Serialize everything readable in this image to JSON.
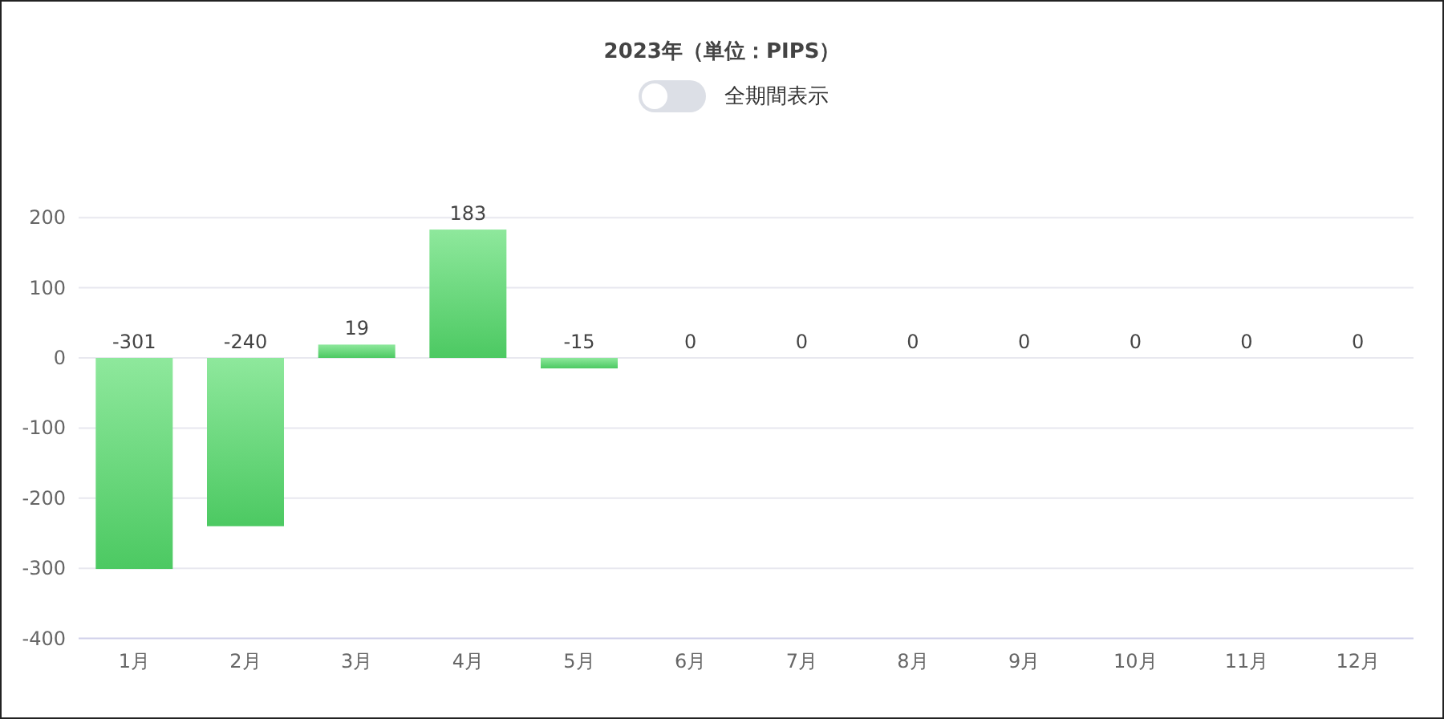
{
  "title": "2023年（単位：PIPS）",
  "toggle": {
    "label": "全期間表示",
    "on": false
  },
  "chart_data": {
    "type": "bar",
    "categories": [
      "1月",
      "2月",
      "3月",
      "4月",
      "5月",
      "6月",
      "7月",
      "8月",
      "9月",
      "10月",
      "11月",
      "12月"
    ],
    "series": [
      {
        "color": "#4cc962",
        "values": [
          -301,
          -240,
          19,
          183,
          -15,
          0,
          0,
          0,
          0,
          0,
          0,
          0
        ]
      }
    ],
    "ylim": [
      -400,
      200
    ],
    "grid": true,
    "yticks": [
      -400,
      -300,
      -200,
      -100,
      0,
      100,
      200
    ],
    "data_labels": true
  }
}
